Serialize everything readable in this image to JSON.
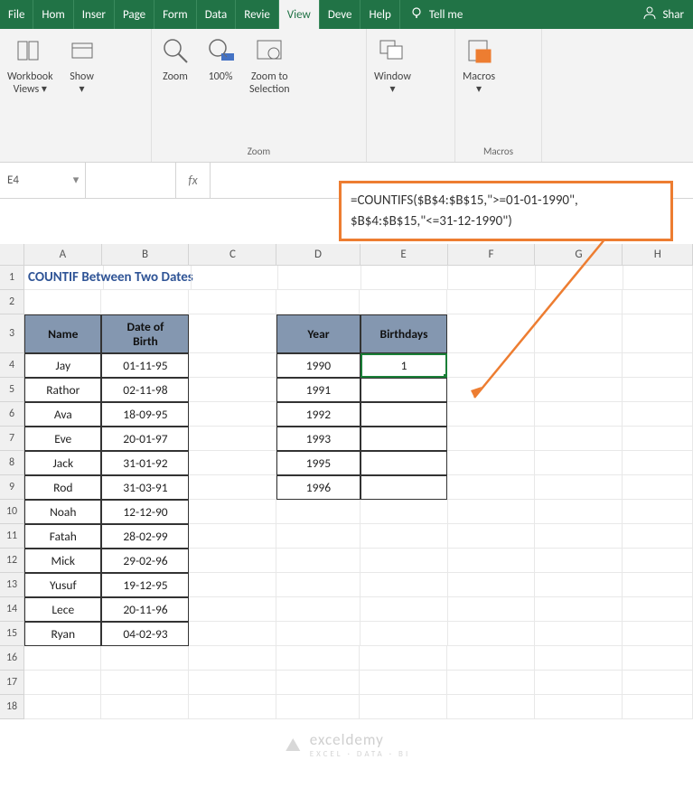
{
  "menu": {
    "tabs": [
      "File",
      "Hom",
      "Inser",
      "Page",
      "Form",
      "Data",
      "Revie",
      "View",
      "Deve",
      "Help"
    ],
    "active": 7,
    "tellme": "Tell me",
    "share": "Shar"
  },
  "ribbon": {
    "g1": {
      "btnA": "Workbook\nViews ▾",
      "btnB": "Show\n▾",
      "label": ""
    },
    "g2": {
      "btnA": "Zoom",
      "btnB": "100%",
      "btnC": "Zoom to\nSelection",
      "label": "Zoom"
    },
    "g3": {
      "btnA": "Window\n▾",
      "label": ""
    },
    "g4": {
      "btnA": "Macros\n▾",
      "label": "Macros"
    }
  },
  "nameBox": "E4",
  "fx": "fx",
  "formula": {
    "line1": "=COUNTIFS($B$4:$B$15,\">=01-01-1990\",",
    "line2": "$B$4:$B$15,\"<=31-12-1990\")"
  },
  "title": "COUNTIF Between Two Dates",
  "tableAB": {
    "hA": "Name",
    "hB": "Date of\nBirth",
    "rows": [
      {
        "a": "Jay",
        "b": "01-11-95"
      },
      {
        "a": "Rathor",
        "b": "02-11-98"
      },
      {
        "a": "Ava",
        "b": "18-09-95"
      },
      {
        "a": "Eve",
        "b": "20-01-97"
      },
      {
        "a": "Jack",
        "b": "31-01-92"
      },
      {
        "a": "Rod",
        "b": "31-03-91"
      },
      {
        "a": "Noah",
        "b": "12-12-90"
      },
      {
        "a": "Fatah",
        "b": "28-02-99"
      },
      {
        "a": "Mick",
        "b": "29-02-96"
      },
      {
        "a": "Yusuf",
        "b": "19-12-95"
      },
      {
        "a": "Lece",
        "b": "20-11-96"
      },
      {
        "a": "Ryan",
        "b": "04-02-93"
      }
    ]
  },
  "tableDE": {
    "hD": "Year",
    "hE": "Birthdays",
    "rows": [
      {
        "d": "1990",
        "e": "1"
      },
      {
        "d": "1991",
        "e": ""
      },
      {
        "d": "1992",
        "e": ""
      },
      {
        "d": "1993",
        "e": ""
      },
      {
        "d": "1995",
        "e": ""
      },
      {
        "d": "1996",
        "e": ""
      }
    ]
  },
  "columns": [
    "A",
    "B",
    "C",
    "D",
    "E",
    "F",
    "G",
    "H"
  ],
  "rowNums": [
    "1",
    "2",
    "3",
    "4",
    "5",
    "6",
    "7",
    "8",
    "9",
    "10",
    "11",
    "12",
    "13",
    "14",
    "15",
    "16",
    "17",
    "18"
  ],
  "watermark": {
    "brand": "exceldemy",
    "tag": "EXCEL · DATA · BI"
  }
}
